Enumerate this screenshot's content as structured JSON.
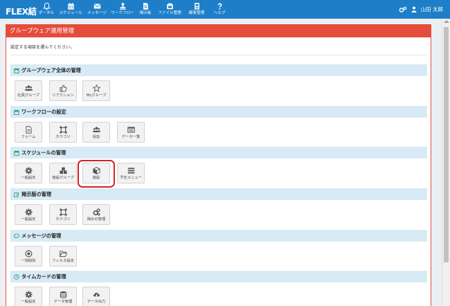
{
  "app": {
    "logo": "FLEX結"
  },
  "nav": [
    {
      "label": "ポータル",
      "icon": "bell-icon"
    },
    {
      "label": "スケジュール",
      "icon": "calendar-icon"
    },
    {
      "label": "メッセージ",
      "icon": "envelope-icon"
    },
    {
      "label": "ワークフロー",
      "icon": "workflow-stamp-icon"
    },
    {
      "label": "掲示板",
      "icon": "bulletin-board-icon"
    },
    {
      "label": "ファイル管理",
      "icon": "folder-icon"
    },
    {
      "label": "顧客管理",
      "icon": "customer-icon"
    },
    {
      "label": "ヘルプ",
      "icon": "question-icon"
    }
  ],
  "user": {
    "name": "山田 太郎"
  },
  "panel": {
    "title": "グループウェア運用管理",
    "instruction": "設定する項目を選んでください。"
  },
  "sections": [
    {
      "title": "グループウェア全体の管理",
      "icon": "calendar-icon",
      "tiles": [
        {
          "label": "社員グループ",
          "icon": "users-icon"
        },
        {
          "label": "リアクション",
          "icon": "thumbs-up-icon"
        },
        {
          "label": "Myグループ",
          "icon": "star-icon"
        }
      ]
    },
    {
      "title": "ワークフローの設定",
      "icon": "calendar-icon",
      "tiles": [
        {
          "label": "フォーム",
          "icon": "document-icon"
        },
        {
          "label": "カテゴリ",
          "icon": "category-icon"
        },
        {
          "label": "役割",
          "icon": "users-icon"
        },
        {
          "label": "データ一覧",
          "icon": "list-icon"
        }
      ]
    },
    {
      "title": "スケジュールの管理",
      "icon": "calendar-icon",
      "tiles": [
        {
          "label": "一般設定",
          "icon": "gear-icon"
        },
        {
          "label": "施設グループ",
          "icon": "cubes-icon"
        },
        {
          "label": "施設",
          "icon": "cube-icon"
        },
        {
          "label": "予定メニュー",
          "icon": "menu-icon"
        }
      ]
    },
    {
      "title": "掲示版の管理",
      "icon": "edit-icon",
      "tiles": [
        {
          "label": "一般設定",
          "icon": "gear-icon"
        },
        {
          "label": "カテゴリ",
          "icon": "category-icon"
        },
        {
          "label": "掲示の管理",
          "icon": "gears-icon"
        }
      ]
    },
    {
      "title": "メッセージの管理",
      "icon": "chat-icon",
      "tiles": [
        {
          "label": "一括削除",
          "icon": "circle-dot-icon"
        },
        {
          "label": "フィルタ設定",
          "icon": "folder-open-icon"
        }
      ]
    },
    {
      "title": "タイムカードの管理",
      "icon": "clock-icon",
      "tiles": [
        {
          "label": "一般設定",
          "icon": "gear-icon"
        },
        {
          "label": "データ管理",
          "icon": "database-icon"
        },
        {
          "label": "データ出力",
          "icon": "cloud-download-icon"
        }
      ]
    }
  ],
  "colors": {
    "topbar": "#1e7fc8",
    "panel_header": "#e54c3c",
    "section_header": "#d8eaf5",
    "section_icon": "#2aa36b",
    "highlight": "#d42020"
  }
}
